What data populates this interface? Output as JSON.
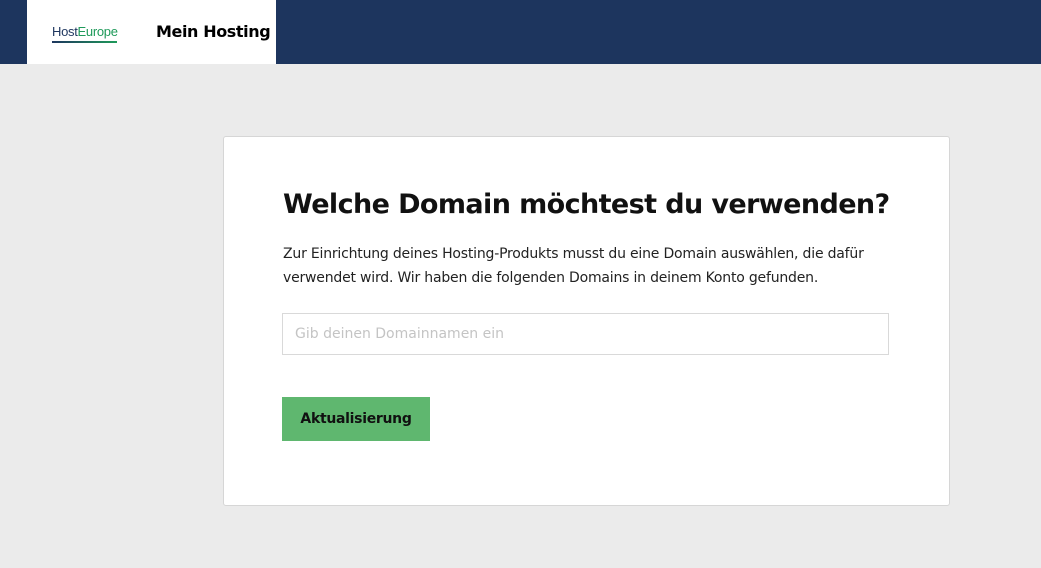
{
  "header": {
    "logo": {
      "word_host": "Host",
      "word_europe": "Europe",
      "colors": {
        "host": "#1d355e",
        "europe": "#1f9a5a"
      }
    },
    "app_title": "Mein Hosting",
    "bar_color": "#1d355e"
  },
  "card": {
    "title": "Welche Domain möchtest du verwenden?",
    "description": "Zur Einrichtung deines Hosting-Produkts musst du eine Domain auswählen, die dafür verwendet wird. Wir haben die folgenden Domains in deinem Konto gefunden.",
    "domain_input": {
      "value": "",
      "placeholder": "Gib deinen Domainnamen ein"
    },
    "update_button": {
      "label": "Aktualisierung",
      "color": "#5fb76f"
    }
  }
}
